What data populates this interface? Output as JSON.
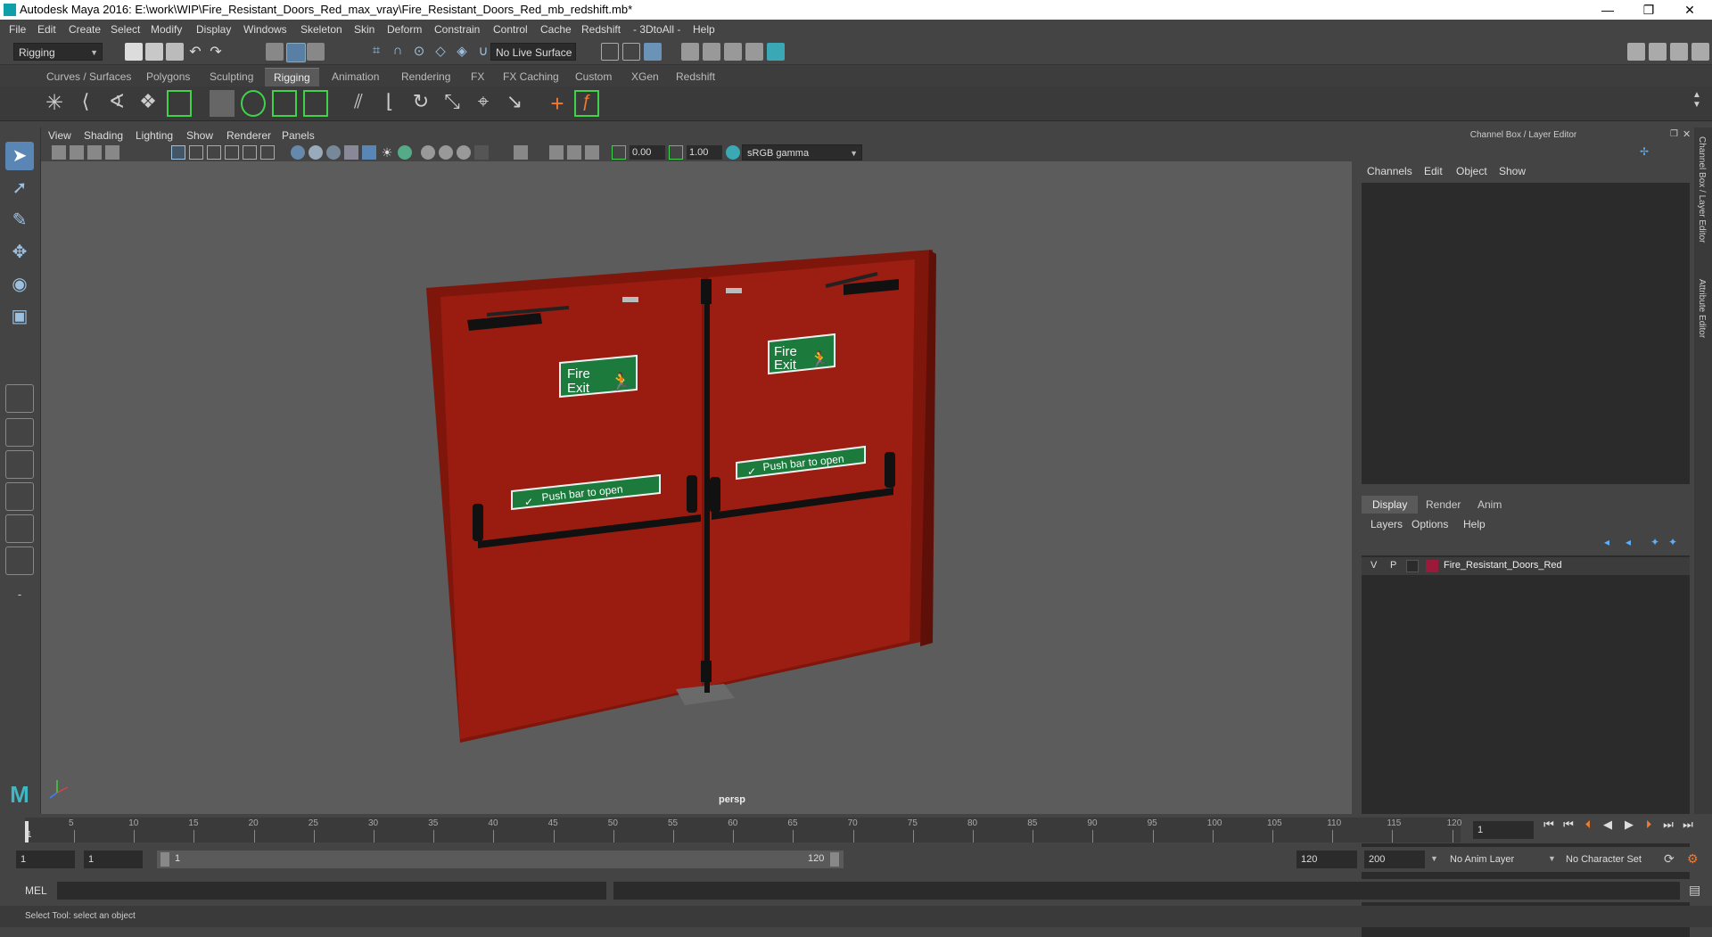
{
  "window": {
    "title": "Autodesk Maya 2016: E:\\work\\WIP\\Fire_Resistant_Doors_Red_max_vray\\Fire_Resistant_Doors_Red_mb_redshift.mb*",
    "minimize": "—",
    "restore": "❐",
    "close": "✕"
  },
  "menubar": [
    "File",
    "Edit",
    "Create",
    "Select",
    "Modify",
    "Display",
    "Windows",
    "Skeleton",
    "Skin",
    "Deform",
    "Constrain",
    "Control",
    "Cache",
    "Redshift",
    "- 3DtoAll -",
    "Help"
  ],
  "statusline": {
    "mode": "Rigging",
    "live_surface": "No Live Surface"
  },
  "shelf_tabs": [
    {
      "label": "Curves / Surfaces",
      "active": false
    },
    {
      "label": "Polygons",
      "active": false
    },
    {
      "label": "Sculpting",
      "active": false
    },
    {
      "label": "Rigging",
      "active": true
    },
    {
      "label": "Animation",
      "active": false
    },
    {
      "label": "Rendering",
      "active": false
    },
    {
      "label": "FX",
      "active": false
    },
    {
      "label": "FX Caching",
      "active": false
    },
    {
      "label": "Custom",
      "active": false
    },
    {
      "label": "XGen",
      "active": false
    },
    {
      "label": "Redshift",
      "active": false
    }
  ],
  "viewport": {
    "menu": [
      "View",
      "Shading",
      "Lighting",
      "Show",
      "Renderer",
      "Panels"
    ],
    "exposure": "0.00",
    "gamma": "1.00",
    "color_space": "sRGB gamma",
    "camera": "persp"
  },
  "scene": {
    "sign_left_line1": "Fire",
    "sign_left_line2": "Exit",
    "sign_right_line1": "Fire",
    "sign_right_line2": "Exit",
    "push_left": "Push bar to open",
    "push_right": "Push bar to open",
    "door_color": "#9a1c10"
  },
  "channel_box": {
    "header": "Channel Box / Layer Editor",
    "menu": [
      "Channels",
      "Edit",
      "Object",
      "Show"
    ]
  },
  "layer_editor": {
    "tabs": [
      {
        "label": "Display",
        "active": true
      },
      {
        "label": "Render",
        "active": false
      },
      {
        "label": "Anim",
        "active": false
      }
    ],
    "menu": [
      "Layers",
      "Options",
      "Help"
    ],
    "layer": {
      "v": "V",
      "p": "P",
      "name": "Fire_Resistant_Doors_Red",
      "color": "#9b1a3a"
    }
  },
  "side_tabs": [
    "Channel Box / Layer Editor",
    "Attribute Editor"
  ],
  "timeline": {
    "ticks": [
      "5",
      "10",
      "15",
      "20",
      "25",
      "30",
      "35",
      "40",
      "45",
      "50",
      "55",
      "60",
      "65",
      "70",
      "75",
      "80",
      "85",
      "90",
      "95",
      "100",
      "105",
      "110",
      "115",
      "120"
    ],
    "start_label": "1",
    "current_frame": "1"
  },
  "range": {
    "start": "1",
    "playback_start": "1",
    "slider_start": "1",
    "slider_end": "120",
    "playback_end": "120",
    "end": "200",
    "anim_layer": "No Anim Layer",
    "char_set": "No Character Set"
  },
  "command": {
    "label": "MEL"
  },
  "help": {
    "text": "Select Tool: select an object"
  }
}
